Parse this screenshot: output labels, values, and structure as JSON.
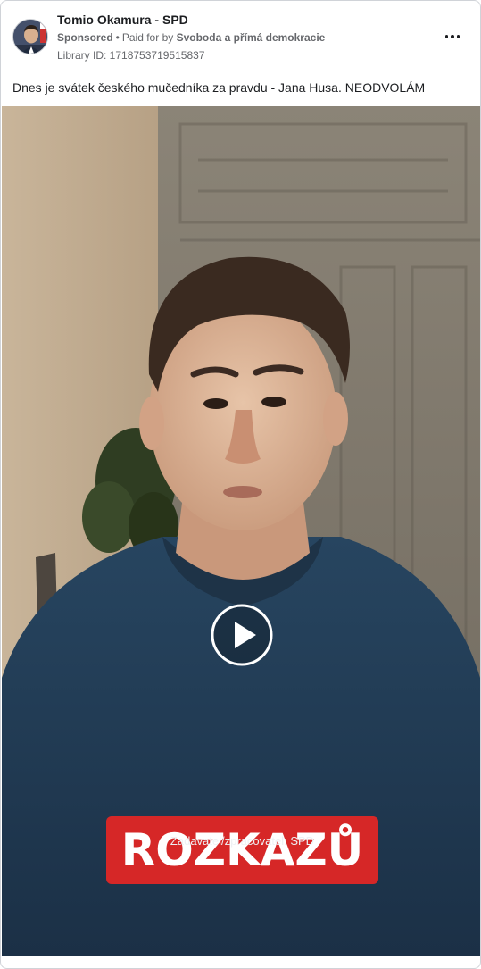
{
  "ad": {
    "page_name": "Tomio Okamura - SPD",
    "sponsored_label": "Sponsored",
    "paid_for_prefix": "Paid for by",
    "paid_for_by": "Svoboda a přímá demokracie",
    "library_id": "Library ID: 1718753719515837",
    "body_text": "Dnes je svátek českého mučedníka za pravdu - Jana Husa. NEODVOLÁM"
  },
  "video": {
    "caption": "ROZKAZŮ",
    "sponsor_note": "Zadavatel/zpracovatel: SPD"
  },
  "icons": {
    "more": "more-horizontal-icon",
    "play": "play-icon"
  },
  "colors": {
    "caption_bg": "#d62727",
    "shirt": "#213a50",
    "text_secondary": "#65676b"
  }
}
